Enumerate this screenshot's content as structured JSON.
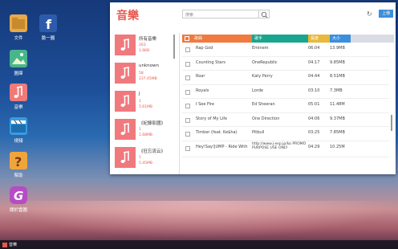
{
  "desktop": {
    "icons": [
      {
        "label": "文件",
        "color": "#e8a94a"
      },
      {
        "label": "臉一圓",
        "color": "#2c5bab"
      },
      {
        "label": "圖庫",
        "color": "#49b58a"
      },
      {
        "label": "音樂",
        "color": "#ef7a77"
      },
      {
        "label": "視頻",
        "color": "#3a9be0"
      },
      {
        "label": "幫助",
        "color": "#f0a53c"
      },
      {
        "label": "關於雲圖",
        "color": "#b64cc5"
      }
    ]
  },
  "taskbar": {
    "item": "音樂"
  },
  "window": {
    "title": "音樂",
    "search_placeholder": "搜索",
    "upload_label": "上傳",
    "albums": [
      {
        "name": "所有音樂",
        "count": "263",
        "size": "1.6KB"
      },
      {
        "name": "unknown",
        "count": "58",
        "size": "237.45MB"
      },
      {
        "name": "J",
        "count": "1",
        "size": "5.61MB"
      },
      {
        "name": "《紀錄影國》",
        "count": "1",
        "size": "1.68MB"
      },
      {
        "name": "《狂忘流云》",
        "count": "1",
        "size": "5.45MB"
      }
    ],
    "columns": {
      "title": "歌曲",
      "artist": "歌手",
      "duration": "長度",
      "size": "大小"
    },
    "songs": [
      {
        "title": "Rap God",
        "artist": "Eminem",
        "duration": "06:04",
        "size": "13.9MB"
      },
      {
        "title": "Counting Stars",
        "artist": "OneRepublic",
        "duration": "04:17",
        "size": "9.85MB"
      },
      {
        "title": "Roar",
        "artist": "Katy Perry",
        "duration": "04:44",
        "size": "8.51MB"
      },
      {
        "title": "Royals",
        "artist": "Lorde",
        "duration": "03:10",
        "size": "7.3MB"
      },
      {
        "title": "I See Fire",
        "artist": "Ed Sheeran",
        "duration": "05:01",
        "size": "11.48M"
      },
      {
        "title": "Story of My Life",
        "artist": "One Direction",
        "duration": "04:06",
        "size": "9.37MB"
      },
      {
        "title": "Timber (feat. Ke$ha)",
        "artist": "Pitbull",
        "duration": "03:25",
        "size": "7.85MB"
      },
      {
        "title": "Hey!Say!JUMP - Ride With",
        "artist": "http://www.j-esp.jp/ko PROMO PURPOSE USE ONLY",
        "duration": "04:29",
        "size": "10.25M"
      }
    ]
  },
  "colors": {
    "accent": "#e8584f",
    "col_title": "#f07a3f",
    "col_artist": "#1aa58e",
    "col_duration": "#e8b93a",
    "col_size": "#3b8fdc"
  }
}
